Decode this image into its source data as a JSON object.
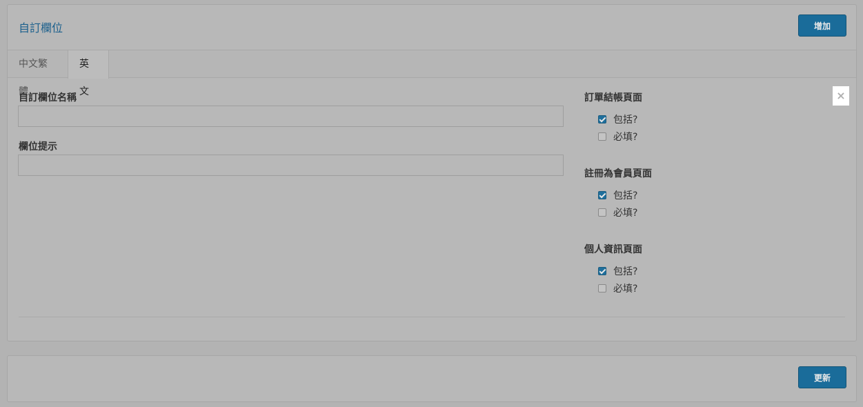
{
  "header": {
    "title": "自訂欄位",
    "add_label": "增加"
  },
  "tabs": [
    {
      "label": "中文繁體",
      "active": false
    },
    {
      "label": "英文",
      "active": true
    }
  ],
  "form": {
    "name_label": "自訂欄位名稱",
    "name_value": "",
    "hint_label": "欄位提示",
    "hint_value": ""
  },
  "close_symbol": "×",
  "sections": [
    {
      "title": "訂單結帳頁面",
      "include_label": "包括?",
      "include_checked": true,
      "required_label": "必填?",
      "required_checked": false
    },
    {
      "title": "註冊為會員頁面",
      "include_label": "包括?",
      "include_checked": true,
      "required_label": "必填?",
      "required_checked": false
    },
    {
      "title": "個人資訊頁面",
      "include_label": "包括?",
      "include_checked": true,
      "required_label": "必填?",
      "required_checked": false
    }
  ],
  "footer": {
    "update_label": "更新"
  },
  "colors": {
    "accent": "#1a6c9a",
    "title": "#1a5f8c"
  }
}
